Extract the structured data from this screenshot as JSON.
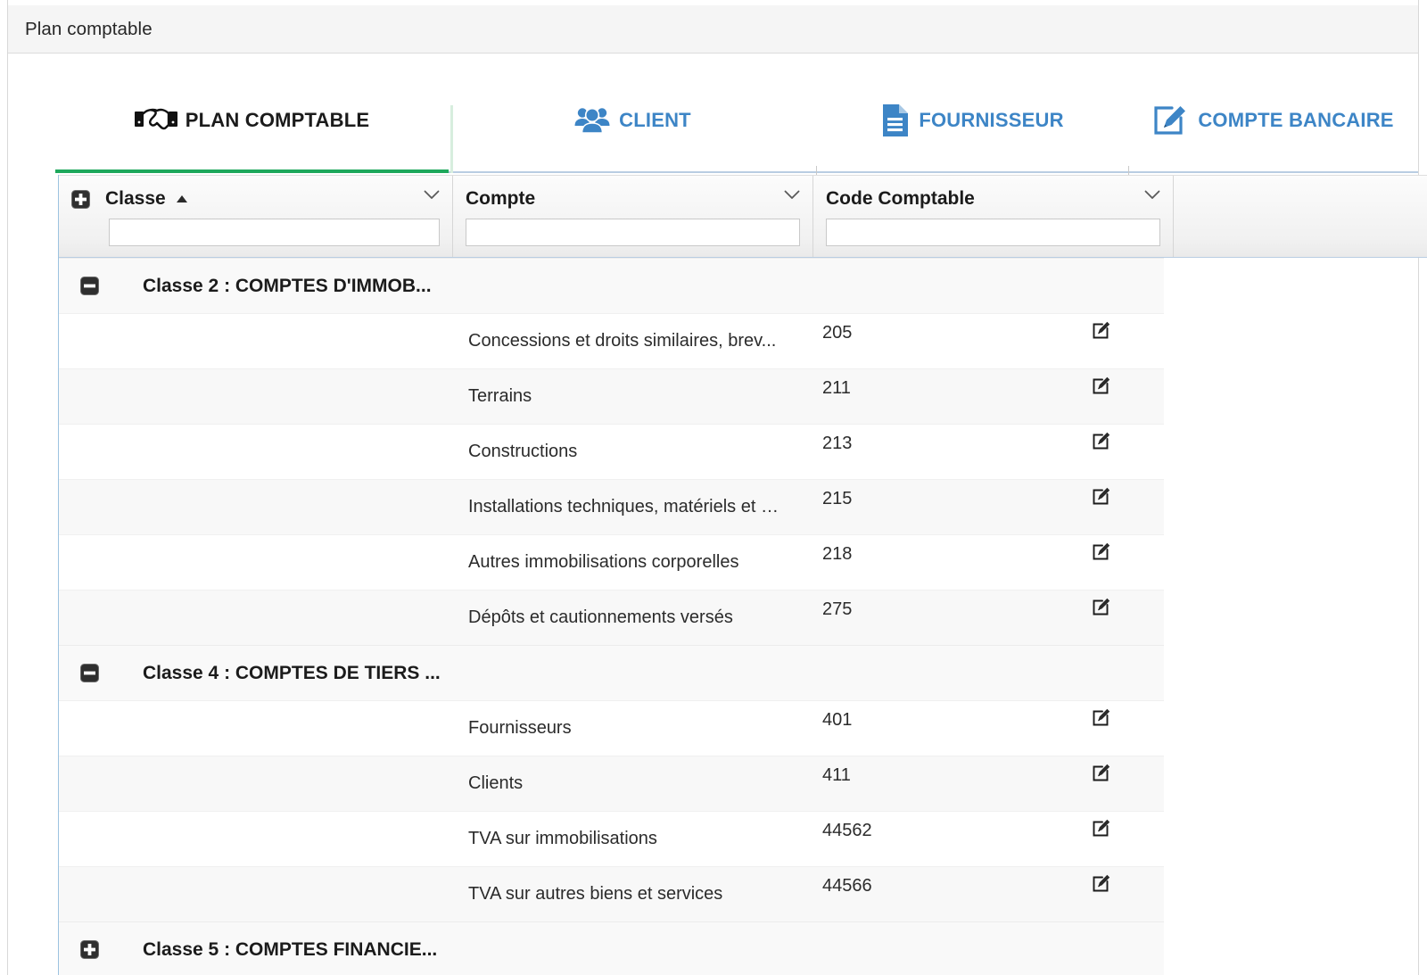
{
  "window": {
    "title": "Plan comptable"
  },
  "tabs": [
    {
      "label": "PLAN COMPTABLE",
      "icon": "handshake-icon",
      "active": true,
      "color": "#1b1b1b"
    },
    {
      "label": "CLIENT",
      "icon": "people-group-icon",
      "active": false,
      "color": "#3d85c6"
    },
    {
      "label": "FOURNISSEUR",
      "icon": "document-icon",
      "active": false,
      "color": "#3d85c6"
    },
    {
      "label": "COMPTE BANCAIRE",
      "icon": "edit-square-icon",
      "active": false,
      "color": "#3d85c6"
    }
  ],
  "theme": {
    "active_tab_underline": "#1ea85c",
    "tab_link_blue": "#3d85c6",
    "grid_border_blue": "#9cc3e0"
  },
  "grid": {
    "columns": [
      {
        "title": "Classe",
        "sorted": "asc",
        "has_expand_all": true,
        "filter_value": "",
        "filter_placeholder": ""
      },
      {
        "title": "Compte",
        "sorted": "none",
        "has_expand_all": false,
        "filter_value": "",
        "filter_placeholder": ""
      },
      {
        "title": "Code Comptable",
        "sorted": "none",
        "has_expand_all": false,
        "filter_value": "",
        "filter_placeholder": ""
      },
      {
        "title": "",
        "sorted": "none",
        "has_expand_all": false,
        "filter_value": null,
        "filter_placeholder": ""
      }
    ],
    "groups": [
      {
        "label": "Classe 2 : COMPTES D'IMMOB...",
        "expanded": true,
        "rows": [
          {
            "compte": "Concessions et droits similaires, brev...",
            "code": "205",
            "action": "edit-icon"
          },
          {
            "compte": "Terrains",
            "code": "211",
            "action": "edit-icon"
          },
          {
            "compte": "Constructions",
            "code": "213",
            "action": "edit-icon"
          },
          {
            "compte": "Installations techniques, matériels et …",
            "code": "215",
            "action": "edit-icon"
          },
          {
            "compte": "Autres immobilisations corporelles",
            "code": "218",
            "action": "edit-icon"
          },
          {
            "compte": "Dépôts et cautionnements versés",
            "code": "275",
            "action": "edit-icon"
          }
        ]
      },
      {
        "label": "Classe 4 : COMPTES DE TIERS ...",
        "expanded": true,
        "rows": [
          {
            "compte": "Fournisseurs",
            "code": "401",
            "action": "edit-icon"
          },
          {
            "compte": "Clients",
            "code": "411",
            "action": "edit-icon"
          },
          {
            "compte": "TVA sur immobilisations",
            "code": "44562",
            "action": "edit-icon"
          },
          {
            "compte": "TVA sur autres biens et services",
            "code": "44566",
            "action": "edit-icon"
          }
        ]
      },
      {
        "label": "Classe 5 : COMPTES FINANCIE...",
        "expanded": false,
        "rows": []
      }
    ]
  }
}
